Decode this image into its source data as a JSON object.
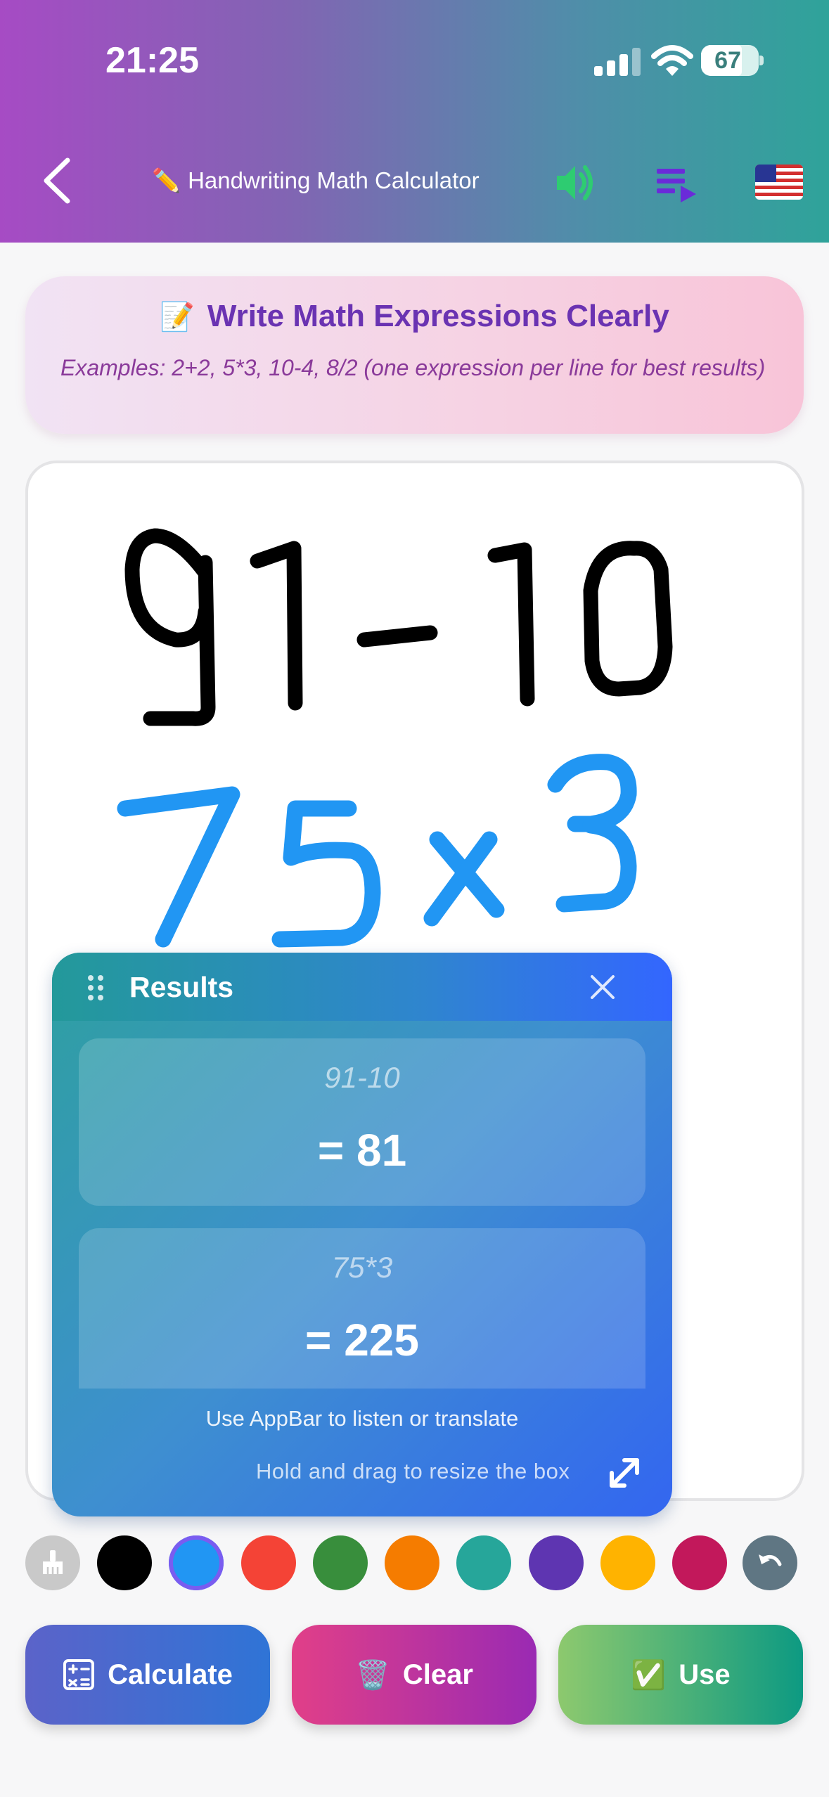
{
  "status_bar": {
    "time": "21:25",
    "battery": "67"
  },
  "app_bar": {
    "title": "Handwriting Math Calculator",
    "title_emoji": "✏️"
  },
  "info_card": {
    "emoji": "📝",
    "title": "Write Math Expressions Clearly",
    "examples": "Examples: 2+2, 5*3, 10-4, 8/2 (one expression per line for best results)"
  },
  "canvas": {
    "lines": [
      {
        "text": "91-10",
        "color": "#000000"
      },
      {
        "text": "75x3",
        "color": "#2196f3"
      }
    ]
  },
  "results": {
    "title": "Results",
    "items": [
      {
        "expression": "91-10",
        "value": "= 81"
      },
      {
        "expression": "75*3",
        "value": "= 225"
      }
    ],
    "hint_appbar": "Use AppBar to listen or translate",
    "hint_resize": "Hold and drag to resize the box"
  },
  "palette": {
    "colors": [
      "#000000",
      "#2196f3",
      "#f44336",
      "#388e3c",
      "#f57c00",
      "#26a69a",
      "#5e35b1",
      "#ffb300",
      "#c2185b"
    ],
    "selected": "#2196f3"
  },
  "buttons": {
    "calculate": "Calculate",
    "clear": "Clear",
    "clear_emoji": "🗑️",
    "use": "Use",
    "use_emoji": "✅"
  }
}
